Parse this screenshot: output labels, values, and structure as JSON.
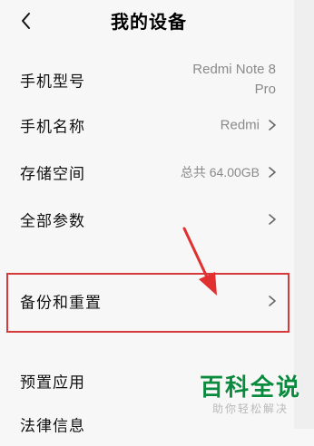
{
  "header": {
    "title": "我的设备",
    "back_icon": "chevron-left-icon"
  },
  "rows": [
    {
      "label": "手机型号",
      "value": "Redmi Note 8 Pro",
      "value_line1": "Redmi Note 8",
      "value_line2": "Pro",
      "chevron": false
    },
    {
      "label": "手机名称",
      "value": "Redmi",
      "chevron": true
    },
    {
      "label": "存储空间",
      "value": "总共 64.00GB",
      "chevron": true
    },
    {
      "label": "全部参数",
      "value": "",
      "chevron": true
    },
    {
      "label": "备份和重置",
      "value": "",
      "chevron": true,
      "highlighted": true
    },
    {
      "label": "预置应用",
      "value": "",
      "chevron": false
    },
    {
      "label": "法律信息",
      "value": "",
      "chevron": false
    }
  ],
  "annotation": {
    "highlight_color": "#d63a3a",
    "arrow_color": "#e03030"
  },
  "watermark": {
    "title": "百科全说",
    "subtitle": "助你轻松解决"
  }
}
